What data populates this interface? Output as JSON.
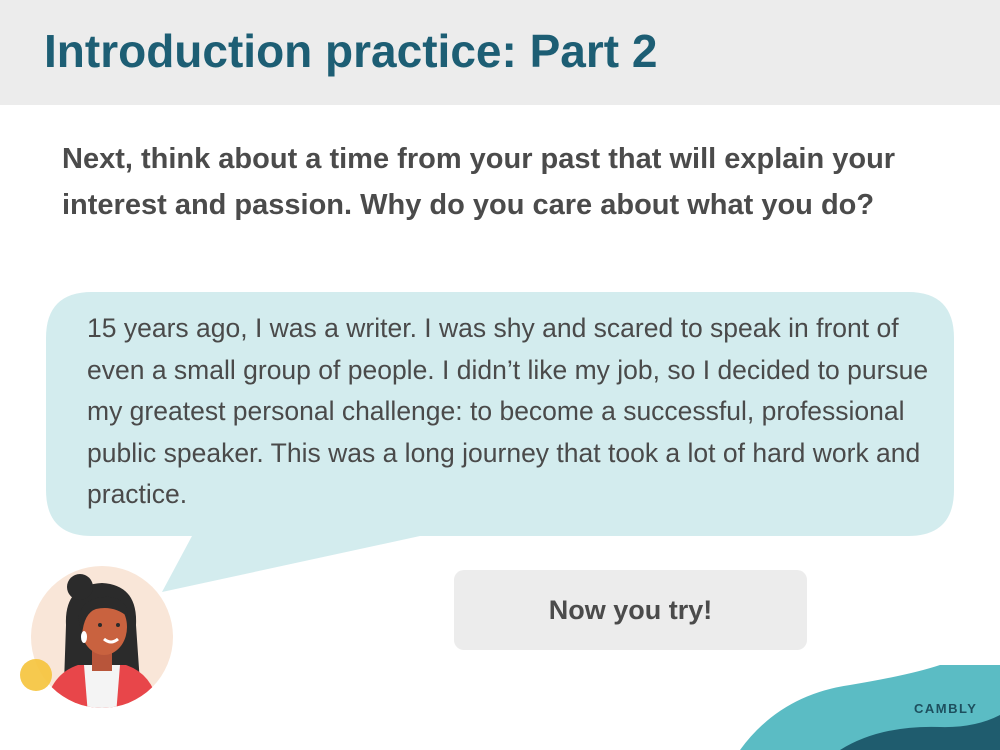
{
  "header": {
    "title": "Introduction practice: Part 2"
  },
  "prompt": {
    "text": "Next, think about a time from your past that will explain your interest and passion. Why do you care about what you do?"
  },
  "speech_bubble": {
    "text": "15 years ago, I was a writer. I was shy and scared to speak in front of even a small group of people. I didn’t like my job, so I decided to pursue my greatest personal challenge: to become a successful, professional public speaker. This was a long journey that took a lot of hard work and practice."
  },
  "action": {
    "button_label": "Now you try!"
  },
  "brand": {
    "logo_text": "CAMBLY"
  },
  "colors": {
    "title": "#1d5e74",
    "bubble": "#d3ecee",
    "band": "#ececec",
    "accent_teal": "#5bbcc4",
    "accent_yellow": "#f5c33b"
  },
  "icons": {
    "avatar": "woman-avatar-icon"
  }
}
